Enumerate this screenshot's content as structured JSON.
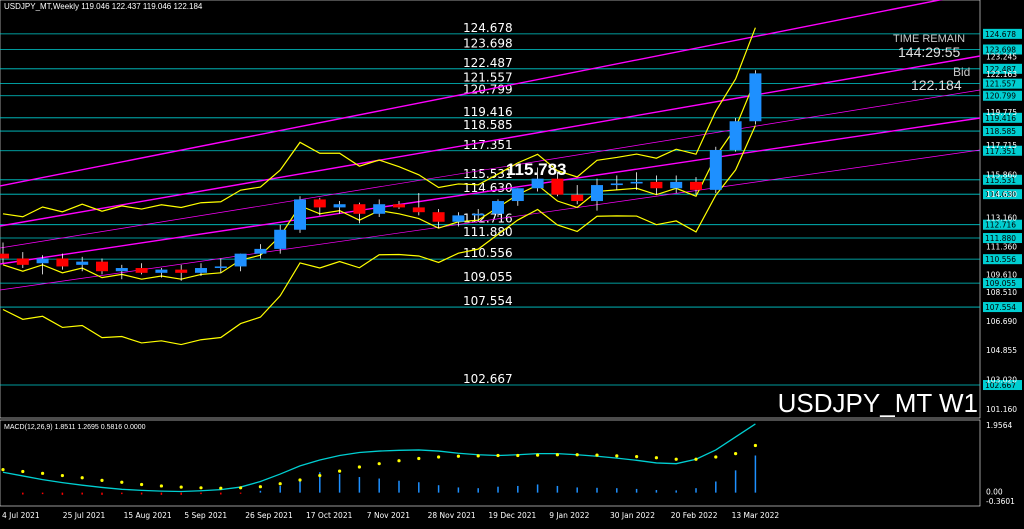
{
  "header": {
    "title": "USDJPY_MT,Weekly  119.046 122.437 119.046 122.184"
  },
  "symbol_label": "USDJPY_MT W1",
  "time_remain": {
    "label": "TIME REMAIN",
    "value": "144:29:55"
  },
  "bid": {
    "label": "Bid",
    "value": "122.184"
  },
  "current_price_label": "115.783",
  "macd": {
    "label": "MACD(12,26,9) 1.8511 1.2695 0.5816 0.0000",
    "axis_labels": [
      "1.9564",
      "0.00",
      "-0.3601"
    ]
  },
  "colors": {
    "background": "#000000",
    "bull": "#1E90FF",
    "bear": "#FF0000",
    "level_line": "#00CED1",
    "channel_line": "#FF00FF",
    "bands": "#FFFF00"
  },
  "chart_data": {
    "type": "candlestick",
    "symbol": "USDJPY_MT",
    "timeframe": "Weekly",
    "ohlc_header": {
      "open": 119.046,
      "high": 122.437,
      "low": 119.046,
      "close": 122.184
    },
    "x_tick_labels": [
      "4 Jul 2021",
      "25 Jul 2021",
      "15 Aug 2021",
      "5 Sep 2021",
      "26 Sep 2021",
      "17 Oct 2021",
      "7 Nov 2021",
      "28 Nov 2021",
      "19 Dec 2021",
      "9 Jan 2022",
      "30 Jan 2022",
      "20 Feb 2022",
      "13 Mar 2022"
    ],
    "y_axis_labels": [
      "123.245",
      "122.163",
      "119.775",
      "117.715",
      "115.860",
      "114.630",
      "113.160",
      "111.360",
      "109.610",
      "108.510",
      "106.690",
      "104.855",
      "103.020",
      "101.160"
    ],
    "price_levels": [
      {
        "label": "124.678",
        "value": 124.678
      },
      {
        "label": "123.698",
        "value": 123.698
      },
      {
        "label": "122.487",
        "value": 122.487
      },
      {
        "label": "121.557",
        "value": 121.557
      },
      {
        "label": "120.799",
        "value": 120.799
      },
      {
        "label": "119.416",
        "value": 119.416
      },
      {
        "label": "118.585",
        "value": 118.585
      },
      {
        "label": "117.351",
        "value": 117.351
      },
      {
        "label": "115.531",
        "value": 115.531
      },
      {
        "label": "114.630",
        "value": 114.63
      },
      {
        "label": "112.716",
        "value": 112.716
      },
      {
        "label": "111.880",
        "value": 111.88
      },
      {
        "label": "110.556",
        "value": 110.556
      },
      {
        "label": "109.055",
        "value": 109.055
      },
      {
        "label": "107.554",
        "value": 107.554
      },
      {
        "label": "102.667",
        "value": 102.667
      }
    ],
    "candles": [
      {
        "o": 110.9,
        "h": 111.6,
        "l": 110.3,
        "c": 110.6
      },
      {
        "o": 110.6,
        "h": 111.0,
        "l": 110.0,
        "c": 110.2
      },
      {
        "o": 110.3,
        "h": 110.8,
        "l": 109.6,
        "c": 110.6
      },
      {
        "o": 110.6,
        "h": 110.9,
        "l": 109.9,
        "c": 110.1
      },
      {
        "o": 110.2,
        "h": 110.7,
        "l": 109.8,
        "c": 110.4
      },
      {
        "o": 110.4,
        "h": 110.6,
        "l": 109.6,
        "c": 109.8
      },
      {
        "o": 109.8,
        "h": 110.2,
        "l": 109.3,
        "c": 110.0
      },
      {
        "o": 110.0,
        "h": 110.3,
        "l": 109.6,
        "c": 109.7
      },
      {
        "o": 109.7,
        "h": 110.0,
        "l": 109.4,
        "c": 109.9
      },
      {
        "o": 109.9,
        "h": 110.2,
        "l": 109.2,
        "c": 109.7
      },
      {
        "o": 109.7,
        "h": 110.3,
        "l": 109.5,
        "c": 110.0
      },
      {
        "o": 110.0,
        "h": 110.6,
        "l": 109.7,
        "c": 110.1
      },
      {
        "o": 110.1,
        "h": 110.9,
        "l": 109.8,
        "c": 110.9
      },
      {
        "o": 110.9,
        "h": 111.5,
        "l": 110.6,
        "c": 111.2
      },
      {
        "o": 111.2,
        "h": 112.7,
        "l": 110.9,
        "c": 112.4
      },
      {
        "o": 112.4,
        "h": 114.5,
        "l": 112.2,
        "c": 114.3
      },
      {
        "o": 114.3,
        "h": 114.4,
        "l": 113.3,
        "c": 113.8
      },
      {
        "o": 113.8,
        "h": 114.2,
        "l": 113.4,
        "c": 114.0
      },
      {
        "o": 114.0,
        "h": 114.1,
        "l": 112.8,
        "c": 113.4
      },
      {
        "o": 113.4,
        "h": 114.3,
        "l": 113.2,
        "c": 114.0
      },
      {
        "o": 114.0,
        "h": 114.2,
        "l": 113.7,
        "c": 113.8
      },
      {
        "o": 113.8,
        "h": 114.7,
        "l": 113.3,
        "c": 113.5
      },
      {
        "o": 113.5,
        "h": 113.7,
        "l": 112.5,
        "c": 112.9
      },
      {
        "o": 112.9,
        "h": 113.5,
        "l": 112.6,
        "c": 113.3
      },
      {
        "o": 113.3,
        "h": 113.7,
        "l": 112.9,
        "c": 113.4
      },
      {
        "o": 113.4,
        "h": 114.3,
        "l": 113.2,
        "c": 114.2
      },
      {
        "o": 114.2,
        "h": 115.0,
        "l": 113.9,
        "c": 115.0
      },
      {
        "o": 115.0,
        "h": 116.3,
        "l": 114.8,
        "c": 115.6
      },
      {
        "o": 115.6,
        "h": 116.0,
        "l": 114.5,
        "c": 114.6
      },
      {
        "o": 114.6,
        "h": 115.2,
        "l": 114.0,
        "c": 114.2
      },
      {
        "o": 114.2,
        "h": 115.6,
        "l": 113.6,
        "c": 115.2
      },
      {
        "o": 115.2,
        "h": 115.8,
        "l": 114.9,
        "c": 115.3
      },
      {
        "o": 115.3,
        "h": 116.0,
        "l": 114.9,
        "c": 115.4
      },
      {
        "o": 115.4,
        "h": 115.8,
        "l": 114.6,
        "c": 115.0
      },
      {
        "o": 115.0,
        "h": 115.8,
        "l": 114.7,
        "c": 115.4
      },
      {
        "o": 115.4,
        "h": 115.7,
        "l": 114.6,
        "c": 114.9
      },
      {
        "o": 114.9,
        "h": 117.6,
        "l": 114.7,
        "c": 117.4
      },
      {
        "o": 117.4,
        "h": 119.4,
        "l": 117.3,
        "c": 119.2
      },
      {
        "o": 119.2,
        "h": 122.4,
        "l": 119.0,
        "c": 122.2
      }
    ],
    "price_range": [
      100.6,
      126.8
    ],
    "macd_histogram": [
      0.0,
      -0.05,
      -0.04,
      -0.06,
      -0.05,
      -0.06,
      -0.04,
      -0.05,
      -0.06,
      -0.06,
      -0.04,
      -0.05,
      -0.03,
      0.05,
      0.18,
      0.35,
      0.55,
      0.5,
      0.42,
      0.38,
      0.32,
      0.28,
      0.2,
      0.14,
      0.12,
      0.16,
      0.18,
      0.22,
      0.18,
      0.14,
      0.13,
      0.12,
      0.1,
      0.07,
      0.06,
      0.12,
      0.3,
      0.6,
      1.0
    ],
    "macd_line": [
      0.55,
      0.45,
      0.35,
      0.27,
      0.2,
      0.14,
      0.09,
      0.06,
      0.04,
      0.03,
      0.05,
      0.08,
      0.15,
      0.3,
      0.5,
      0.72,
      0.88,
      1.0,
      1.08,
      1.12,
      1.14,
      1.15,
      1.12,
      1.06,
      1.02,
      1.0,
      1.02,
      1.05,
      1.05,
      1.02,
      0.98,
      0.93,
      0.87,
      0.8,
      0.78,
      0.9,
      1.15,
      1.5,
      1.85
    ],
    "macd_signal": [
      0.62,
      0.57,
      0.52,
      0.46,
      0.4,
      0.33,
      0.28,
      0.22,
      0.18,
      0.15,
      0.13,
      0.12,
      0.13,
      0.16,
      0.24,
      0.34,
      0.46,
      0.58,
      0.69,
      0.78,
      0.86,
      0.92,
      0.96,
      0.98,
      0.99,
      1.0,
      1.0,
      1.01,
      1.02,
      1.02,
      1.01,
      0.99,
      0.97,
      0.94,
      0.9,
      0.9,
      0.96,
      1.05,
      1.27
    ],
    "macd_range": [
      -0.3601,
      1.9564
    ],
    "grid": false
  }
}
